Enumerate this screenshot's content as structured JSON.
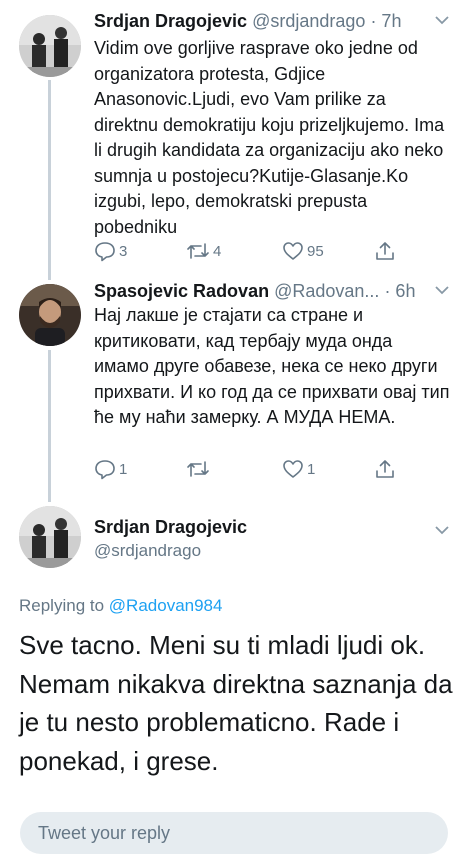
{
  "tweets": [
    {
      "name": "Srdjan Dragojevic",
      "handle": "@srdjandrago",
      "time": "· 7h",
      "text": "Vidim ove gorljive rasprave oko jedne od organizatora protesta, Gdjice Anasonovic.Ljudi, evo Vam prilike za direktnu demokratiju koju prizeljkujemo. Ima li drugih kandidata za organizaciju ako neko sumnja u postojecu?Kutije-Glasanje.Ko izgubi, lepo, demokratski prepusta pobedniku",
      "replies": "3",
      "retweets": "4",
      "likes": "95",
      "avatar_icon": "profile-photo-pair"
    },
    {
      "name": "Spasojevic Radovan",
      "handle": "@Radovan...",
      "time": "· 6h",
      "text": "Нај лакше је стајати са стране и критиковати, кад тербају муда онда имамо друге обавезе, нека се неко други прихвати. И ко год да се прихвати овај тип ће му наћи замерку. А МУДА НЕМА.",
      "replies": "1",
      "retweets": "",
      "likes": "1",
      "avatar_icon": "profile-photo-man"
    }
  ],
  "focused": {
    "name": "Srdjan Dragojevic",
    "handle": "@srdjandrago",
    "replying_prefix": "Replying to",
    "replying_to": "@Radovan984",
    "text": "Sve tacno. Meni su ti mladi ljudi ok. Nemam nikakva direktna saznanja da je tu nesto problematicno. Rade i ponekad, i grese.",
    "avatar_icon": "profile-photo-pair"
  },
  "compose": {
    "placeholder": "Tweet your reply"
  },
  "colors": {
    "text": "#14171a",
    "secondary": "#657786",
    "link": "#1da1f2",
    "thread_line": "#c8d1d9",
    "reply_box": "#e6ecf0"
  }
}
